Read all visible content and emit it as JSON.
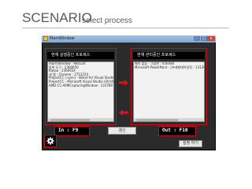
{
  "slide": {
    "title": "SCENARIO",
    "subtitle": "select process"
  },
  "window": {
    "title": "MainWindow",
    "controls": {
      "minimize": "–",
      "maximize": "□",
      "close": "x"
    }
  },
  "left_panel": {
    "header": "현재 실행중인 프로세스",
    "items": [
      "AlarmWindow : 984224",
      "탐색 도구 : 2360650",
      "Kakao : 2360654",
      "새 탭 - Chrome : 2751224",
      "ProjectCC (.sync) - Blend for Visual Studio 20",
      "ProjectCC - Microsoft Visual Studio (관리자)",
      "AMD CC-AltMCapturingWindow : 131780"
    ]
  },
  "right_panel": {
    "header": "현재 관리중인 프로세스",
    "items": [
      "제목 없음 - 그림판 : 656080",
      "Microsoft PowerPoint - [프레젠테이션1] : 131200"
    ]
  },
  "hotkeys": {
    "in": "In : F9",
    "out": "Out : F10"
  },
  "buttons": {
    "center": "갱신",
    "bottom": "설정 하기"
  },
  "colors": {
    "highlight": "#c0131f",
    "arrow": "#d4141e",
    "window_bg": "#2b2b2b"
  },
  "icons": {
    "arrow_right": "arrow-right-icon",
    "arrow_left": "arrow-left-icon",
    "settings": "gear-icon"
  }
}
